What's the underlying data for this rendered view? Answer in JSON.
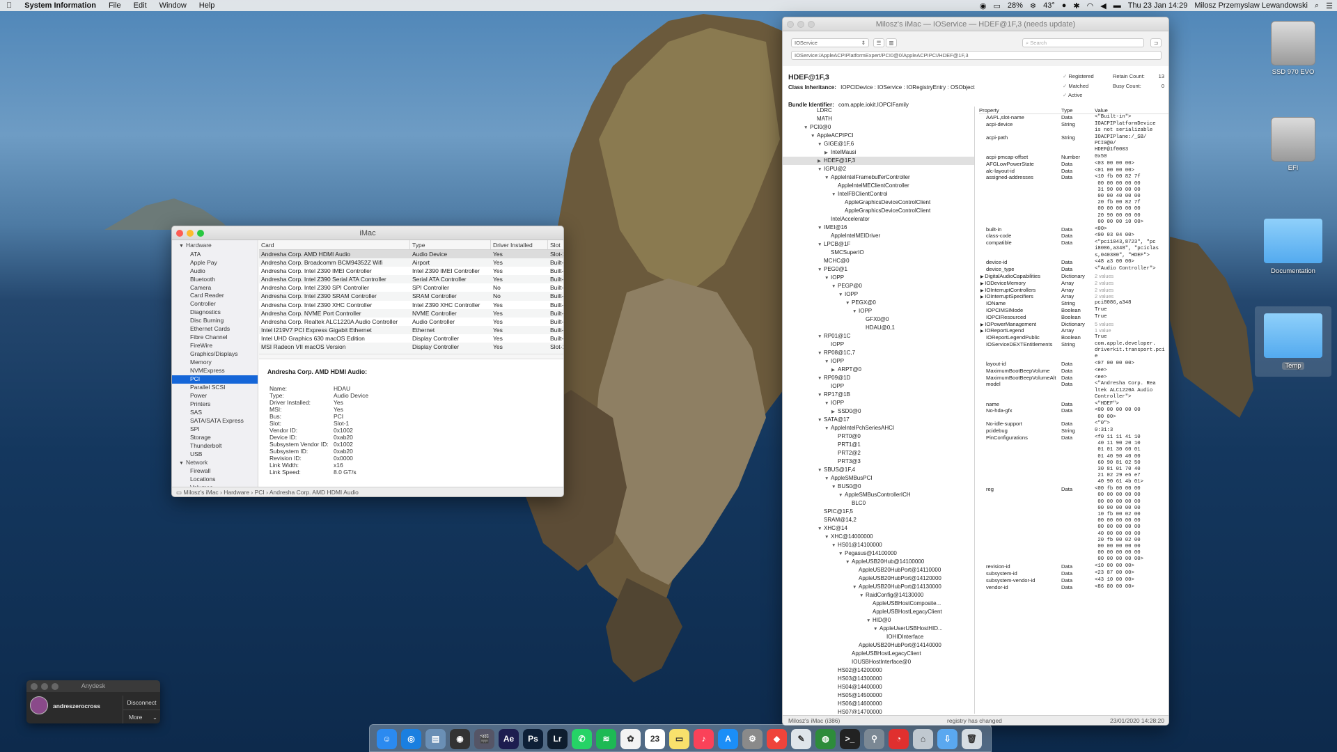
{
  "menubar": {
    "app": "System Information",
    "menus": [
      "File",
      "Edit",
      "Window",
      "Help"
    ],
    "battery": "28%",
    "temp": "43°",
    "datetime": "Thu 23 Jan  14:29",
    "user": "Milosz Przemyslaw Lewandowski"
  },
  "sysinfo": {
    "title": "iMac",
    "sidebar": {
      "hardware_label": "Hardware",
      "hardware_items": [
        "ATA",
        "Apple Pay",
        "Audio",
        "Bluetooth",
        "Camera",
        "Card Reader",
        "Controller",
        "Diagnostics",
        "Disc Burning",
        "Ethernet Cards",
        "Fibre Channel",
        "FireWire",
        "Graphics/Displays",
        "Memory",
        "NVMExpress",
        "PCI",
        "Parallel SCSI",
        "Power",
        "Printers",
        "SAS",
        "SATA/SATA Express",
        "SPI",
        "Storage",
        "Thunderbolt",
        "USB"
      ],
      "network_label": "Network",
      "network_items": [
        "Firewall",
        "Locations",
        "Volumes"
      ]
    },
    "columns": [
      "Card",
      "Type",
      "Driver Installed",
      "Slot"
    ],
    "rows": [
      [
        "Andresha Corp. AMD HDMI Audio",
        "Audio Device",
        "Yes",
        "Slot-1"
      ],
      [
        "Andresha Corp. Broadcomm BCM94352Z Wifi",
        "Airport",
        "Yes",
        "Built-In"
      ],
      [
        "Andresha Corp. Intel Z390 IMEI Controller",
        "Intel Z390 IMEI Controller",
        "Yes",
        "Built-In"
      ],
      [
        "Andresha Corp. Intel Z390 Serial ATA Controller",
        "Serial ATA Controller",
        "Yes",
        "Built-In"
      ],
      [
        "Andresha Corp. Intel Z390 SPI Controller",
        "SPI Controller",
        "No",
        "Built-In"
      ],
      [
        "Andresha Corp. Intel Z390 SRAM Controller",
        "SRAM Controller",
        "No",
        "Built-In"
      ],
      [
        "Andresha Corp. Intel Z390 XHC Controller",
        "Intel Z390 XHC Controller",
        "Yes",
        "Built-In"
      ],
      [
        "Andresha Corp. NVME Port Controller",
        "NVME Controller",
        "Yes",
        "Built-In"
      ],
      [
        "Andresha Corp. Realtek ALC1220A Audio Controller",
        "Audio Controller",
        "Yes",
        "Built-In"
      ],
      [
        "Intel I219V7 PCI Express Gigabit Ethernet",
        "Ethernet",
        "Yes",
        "Built-In"
      ],
      [
        "Intel UHD Graphics 630 macOS Edition",
        "Display Controller",
        "Yes",
        "Built-In"
      ],
      [
        "MSI Radeon VII macOS Version",
        "Display Controller",
        "Yes",
        "Slot-1"
      ]
    ],
    "detail_title": "Andresha Corp. AMD HDMI Audio:",
    "detail": [
      [
        "Name:",
        "HDAU"
      ],
      [
        "Type:",
        "Audio Device"
      ],
      [
        "Driver Installed:",
        "Yes"
      ],
      [
        "MSI:",
        "Yes"
      ],
      [
        "Bus:",
        "PCI"
      ],
      [
        "Slot:",
        "Slot-1"
      ],
      [
        "Vendor ID:",
        "0x1002"
      ],
      [
        "Device ID:",
        "0xab20"
      ],
      [
        "Subsystem Vendor ID:",
        "0x1002"
      ],
      [
        "Subsystem ID:",
        "0xab20"
      ],
      [
        "Revision ID:",
        "0x0000"
      ],
      [
        "Link Width:",
        "x16"
      ],
      [
        "Link Speed:",
        "8.0 GT/s"
      ]
    ],
    "breadcrumb": "Milosz's iMac › Hardware › PCI › Andresha Corp. AMD HDMI Audio"
  },
  "ioreg": {
    "title": "Milosz's iMac — IOService — HDEF@1F,3 (needs update)",
    "plane": "IOService",
    "search_placeholder": "Search",
    "path": "IOService:/AppleACPIPlatformExpert/PCI0@0/AppleACPIPCI/HDEF@1F,3",
    "node": "HDEF@1F,3",
    "class_label": "Class Inheritance:",
    "class_value": "IOPCIDevice : IOService : IORegistryEntry : OSObject",
    "bundle_label": "Bundle Identifier:",
    "bundle_value": "com.apple.iokit.IOPCIFamily",
    "checks": [
      "Registered",
      "Matched",
      "Active"
    ],
    "retain_label": "Retain Count:",
    "retain_value": "13",
    "busy_label": "Busy Count:",
    "busy_value": "0",
    "tree": [
      [
        2,
        "",
        "LDRC"
      ],
      [
        2,
        "",
        "MATH"
      ],
      [
        1,
        "▼",
        "PCI0@0"
      ],
      [
        2,
        "▼",
        "AppleACPIPCI"
      ],
      [
        3,
        "▼",
        "GIGE@1F,6"
      ],
      [
        4,
        "▶",
        "IntelMausi"
      ],
      [
        3,
        "▶",
        "HDEF@1F,3"
      ],
      [
        3,
        "▼",
        "IGPU@2"
      ],
      [
        4,
        "▼",
        "AppleIntelFramebufferController"
      ],
      [
        5,
        "",
        "AppleIntelMEClientController"
      ],
      [
        5,
        "▼",
        "IntelFBClientControl"
      ],
      [
        6,
        "",
        "AppleGraphicsDeviceControlClient"
      ],
      [
        6,
        "",
        "AppleGraphicsDeviceControlClient"
      ],
      [
        4,
        "",
        "IntelAccelerator"
      ],
      [
        3,
        "▼",
        "IMEI@16"
      ],
      [
        4,
        "",
        "AppleIntelMEIDriver"
      ],
      [
        3,
        "▼",
        "LPCB@1F"
      ],
      [
        4,
        "",
        "SMCSuperIO"
      ],
      [
        3,
        "",
        "MCHC@0"
      ],
      [
        3,
        "▼",
        "PEG0@1"
      ],
      [
        4,
        "▼",
        "IOPP"
      ],
      [
        5,
        "▼",
        "PEGP@0"
      ],
      [
        6,
        "▼",
        "IOPP"
      ],
      [
        7,
        "▼",
        "PEGX@0"
      ],
      [
        8,
        "▼",
        "IOPP"
      ],
      [
        9,
        "",
        "GFX0@0"
      ],
      [
        9,
        "",
        "HDAU@0,1"
      ],
      [
        3,
        "▼",
        "RP01@1C"
      ],
      [
        4,
        "",
        "IOPP"
      ],
      [
        3,
        "▼",
        "RP08@1C,7"
      ],
      [
        4,
        "▼",
        "IOPP"
      ],
      [
        5,
        "▶",
        "ARPT@0"
      ],
      [
        3,
        "▼",
        "RP09@1D"
      ],
      [
        4,
        "",
        "IOPP"
      ],
      [
        3,
        "▼",
        "RP17@1B"
      ],
      [
        4,
        "▼",
        "IOPP"
      ],
      [
        5,
        "▶",
        "SSD0@0"
      ],
      [
        3,
        "▼",
        "SATA@17"
      ],
      [
        4,
        "▼",
        "AppleIntelPchSeriesAHCI"
      ],
      [
        5,
        "",
        "PRT0@0"
      ],
      [
        5,
        "",
        "PRT1@1"
      ],
      [
        5,
        "",
        "PRT2@2"
      ],
      [
        5,
        "",
        "PRT3@3"
      ],
      [
        3,
        "▼",
        "SBUS@1F,4"
      ],
      [
        4,
        "▼",
        "AppleSMBusPCI"
      ],
      [
        5,
        "▼",
        "BUS0@0"
      ],
      [
        6,
        "▼",
        "AppleSMBusControllerICH"
      ],
      [
        7,
        "",
        "BLC0"
      ],
      [
        3,
        "",
        "SPIC@1F,5"
      ],
      [
        3,
        "",
        "SRAM@14,2"
      ],
      [
        3,
        "▼",
        "XHC@14"
      ],
      [
        4,
        "▼",
        "XHC@14000000"
      ],
      [
        5,
        "▼",
        "HS01@14100000"
      ],
      [
        6,
        "▼",
        "Pegasus@14100000"
      ],
      [
        7,
        "▼",
        "AppleUSB20Hub@14100000"
      ],
      [
        8,
        "",
        "AppleUSB20HubPort@14110000"
      ],
      [
        8,
        "",
        "AppleUSB20HubPort@14120000"
      ],
      [
        8,
        "▼",
        "AppleUSB20HubPort@14130000"
      ],
      [
        9,
        "▼",
        "RaidConfig@14130000"
      ],
      [
        10,
        "",
        "AppleUSBHostComposite..."
      ],
      [
        10,
        "",
        "AppleUSBHostLegacyClient"
      ],
      [
        10,
        "▼",
        "HID@0"
      ],
      [
        11,
        "▼",
        "AppleUserUSBHostHID..."
      ],
      [
        12,
        "",
        "IOHIDInterface"
      ],
      [
        8,
        "",
        "AppleUSB20HubPort@14140000"
      ],
      [
        7,
        "",
        "AppleUSBHostLegacyClient"
      ],
      [
        7,
        "",
        "IOUSBHostInterface@0"
      ],
      [
        5,
        "",
        "HS02@14200000"
      ],
      [
        5,
        "",
        "HS03@14300000"
      ],
      [
        5,
        "",
        "HS04@14400000"
      ],
      [
        5,
        "",
        "HS05@14500000"
      ],
      [
        5,
        "",
        "HS06@14600000"
      ],
      [
        5,
        "",
        "HS07@14700000"
      ]
    ],
    "prop_cols": [
      "Property",
      "Type",
      "Value"
    ],
    "props": [
      [
        "AAPL,slot-name",
        "Data",
        "<\"Built-in\">",
        0
      ],
      [
        "acpi-device",
        "String",
        "IOACPIPlatformDevice\nis not serializable",
        0
      ],
      [
        "acpi-path",
        "String",
        "IOACPIPlane:/_SB/\nPCI0@0/\nHDEF@1f0003",
        0
      ],
      [
        "acpi-pmcap-offset",
        "Number",
        "0x50",
        0
      ],
      [
        "AFGLowPowerState",
        "Data",
        "<03 00 00 00>",
        0
      ],
      [
        "alc-layout-id",
        "Data",
        "<01 00 00 00>",
        0
      ],
      [
        "assigned-addresses",
        "Data",
        "<10 fb 00 82 7f\n 00 00 00 00 00\n 31 90 00 00 00\n 00 00 40 00 00\n 20 fb 00 82 7f\n 00 00 00 00 00\n 20 90 00 00 00\n 00 00 00 10 00>",
        0
      ],
      [
        "built-in",
        "Data",
        "<00>",
        0
      ],
      [
        "class-code",
        "Data",
        "<00 03 04 00>",
        0
      ],
      [
        "compatible",
        "Data",
        "<\"pci1043,8723\", \"pc\ni8086,a348\", \"pciclas\ns,040300\", \"HDEF\">",
        0
      ],
      [
        "device-id",
        "Data",
        "<48 a3 00 00>",
        0
      ],
      [
        "device_type",
        "Data",
        "<\"Audio Controller\">",
        0
      ],
      [
        "DigitalAudioCapabilities",
        "Dictionary",
        "2 values",
        1
      ],
      [
        "IODeviceMemory",
        "Array",
        "2 values",
        1
      ],
      [
        "IOInterruptControllers",
        "Array",
        "2 values",
        1
      ],
      [
        "IOInterruptSpecifiers",
        "Array",
        "2 values",
        1
      ],
      [
        "IOName",
        "String",
        "pci8086,a348",
        0
      ],
      [
        "IOPCIMSIMode",
        "Boolean",
        "True",
        0
      ],
      [
        "IOPCIResourced",
        "Boolean",
        "True",
        0
      ],
      [
        "IOPowerManagement",
        "Dictionary",
        "5 values",
        1
      ],
      [
        "IOReportLegend",
        "Array",
        "1 value",
        1
      ],
      [
        "IOReportLegendPublic",
        "Boolean",
        "True",
        0
      ],
      [
        "IOServiceDEXTEntitlements",
        "String",
        "com.apple.developer.\ndriverkit.transport.pci\ne",
        0
      ],
      [
        "layout-id",
        "Data",
        "<07 00 00 00>",
        0
      ],
      [
        "MaximumBootBeepVolume",
        "Data",
        "<ee>",
        0
      ],
      [
        "MaximumBootBeepVolumeAlt",
        "Data",
        "<ee>",
        0
      ],
      [
        "model",
        "Data",
        "<\"Andresha Corp. Rea\nltek ALC1220A Audio\nController\">",
        0
      ],
      [
        "name",
        "Data",
        "<\"HDEF\">",
        0
      ],
      [
        "No-hda-gfx",
        "Data",
        "<00 00 00 00 00\n 00 00>",
        0
      ],
      [
        "No-idle-support",
        "Data",
        "<\"0\">",
        0
      ],
      [
        "pcidebug",
        "String",
        "0:31:3",
        0
      ],
      [
        "PinConfigurations",
        "Data",
        "<f0 11 11 41 10\n 40 11 90 20 10\n 01 01 30 60 01\n 01 40 90 40 00\n 60 90 81 02 50\n 30 81 01 70 40\n 21 02 29 e6 e7\n 40 90 61 4b 01>",
        0
      ],
      [
        "reg",
        "Data",
        "<00 fb 00 00 00\n 00 00 00 00 00\n 00 00 00 00 00\n 00 00 00 00 00\n 10 fb 00 02 00\n 00 00 00 00 00\n 00 00 00 00 00\n 40 00 00 00 00\n 20 fb 00 02 00\n 00 00 00 00 00\n 00 00 00 00 00\n 00 00 00 00 00>",
        0
      ],
      [
        "revision-id",
        "Data",
        "<10 00 00 00>",
        0
      ],
      [
        "subsystem-id",
        "Data",
        "<23 87 00 00>",
        0
      ],
      [
        "subsystem-vendor-id",
        "Data",
        "<43 10 00 00>",
        0
      ],
      [
        "vendor-id",
        "Data",
        "<86 80 00 00>",
        0
      ]
    ],
    "footer_left": "Milosz's iMac (i386)",
    "footer_mid": "registry has changed",
    "footer_right": "23/01/2020 14:28:20"
  },
  "anydesk": {
    "title": "Anydesk",
    "user": "andreszerocross",
    "disconnect": "Disconnect",
    "more": "More"
  },
  "desktop": [
    {
      "label": "SSD 970 EVO",
      "icon": "drive-icon"
    },
    {
      "label": "EFI",
      "icon": "drive-icon"
    },
    {
      "label": "Documentation",
      "icon": "folder-icon"
    },
    {
      "label": "Temp",
      "icon": "folder-icon"
    }
  ],
  "dock": {
    "apps": [
      {
        "name": "finder",
        "color": "#2b8af0",
        "glyph": "☺"
      },
      {
        "name": "safari",
        "color": "#1a7fe0",
        "glyph": "◎"
      },
      {
        "name": "preview",
        "color": "#6a8fb5",
        "glyph": "▤"
      },
      {
        "name": "davinci",
        "color": "#333333",
        "glyph": "◉"
      },
      {
        "name": "claquette",
        "color": "#555566",
        "glyph": "🎬"
      },
      {
        "name": "after-effects",
        "color": "#1d1d4f",
        "glyph": "Ae"
      },
      {
        "name": "photoshop",
        "color": "#0d1f37",
        "glyph": "Ps"
      },
      {
        "name": "lightroom",
        "color": "#0e1d2e",
        "glyph": "Lr"
      },
      {
        "name": "whatsapp",
        "color": "#25d366",
        "glyph": "✆"
      },
      {
        "name": "spotify",
        "color": "#1db954",
        "glyph": "≋"
      },
      {
        "name": "photos",
        "color": "#f3f3f3",
        "glyph": "✿"
      },
      {
        "name": "calendar",
        "color": "#ffffff",
        "glyph": "23"
      },
      {
        "name": "notes",
        "color": "#f8e16c",
        "glyph": "▭"
      },
      {
        "name": "music",
        "color": "#fa4259",
        "glyph": "♪"
      },
      {
        "name": "app-store",
        "color": "#1b8ef7",
        "glyph": "A"
      },
      {
        "name": "system-prefs",
        "color": "#8a8a8a",
        "glyph": "⚙"
      },
      {
        "name": "anydesk",
        "color": "#ef443b",
        "glyph": "◆"
      },
      {
        "name": "textedit",
        "color": "#dfe5ea",
        "glyph": "✎"
      },
      {
        "name": "globe",
        "color": "#2d8c3b",
        "glyph": "◍"
      },
      {
        "name": "terminal",
        "color": "#222222",
        "glyph": ">_"
      },
      {
        "name": "automator",
        "color": "#7b8894",
        "glyph": "⚲"
      },
      {
        "name": "speedtest",
        "color": "#e0302f",
        "glyph": "◔"
      },
      {
        "name": "hardware-io",
        "color": "#c0c8d0",
        "glyph": "⌂"
      },
      {
        "name": "downloads",
        "color": "#5aa8f0",
        "glyph": "⇩"
      },
      {
        "name": "trash",
        "color": "#d6dde3",
        "glyph": "🗑"
      }
    ]
  }
}
